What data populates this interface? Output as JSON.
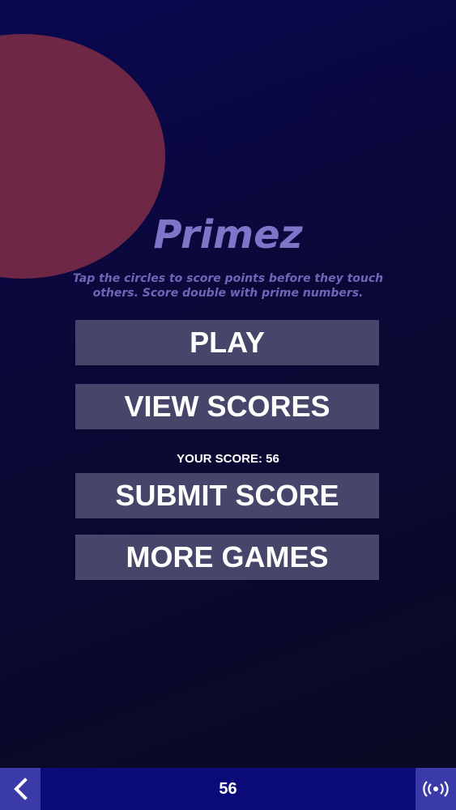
{
  "game": {
    "title": "Primez",
    "subtitle": "Tap the circles to score points before they touch others. Score double with prime numbers.",
    "circle_color": "#6e2846"
  },
  "menu": {
    "play_label": "PLAY",
    "view_scores_label": "VIEW SCORES",
    "your_score_label": "YOUR SCORE: 56",
    "submit_score_label": "SUBMIT SCORE",
    "more_games_label": "MORE GAMES"
  },
  "bottom_bar": {
    "back_icon": "chevron-left-icon",
    "score": "56",
    "broadcast_icon": "broadcast-icon"
  },
  "colors": {
    "background": "#0b0838",
    "button": "#46466a",
    "title": "#7d75c8",
    "bottom_bar": "#0a0a7a",
    "bottom_bar_buttons": "#3a3aa8"
  }
}
